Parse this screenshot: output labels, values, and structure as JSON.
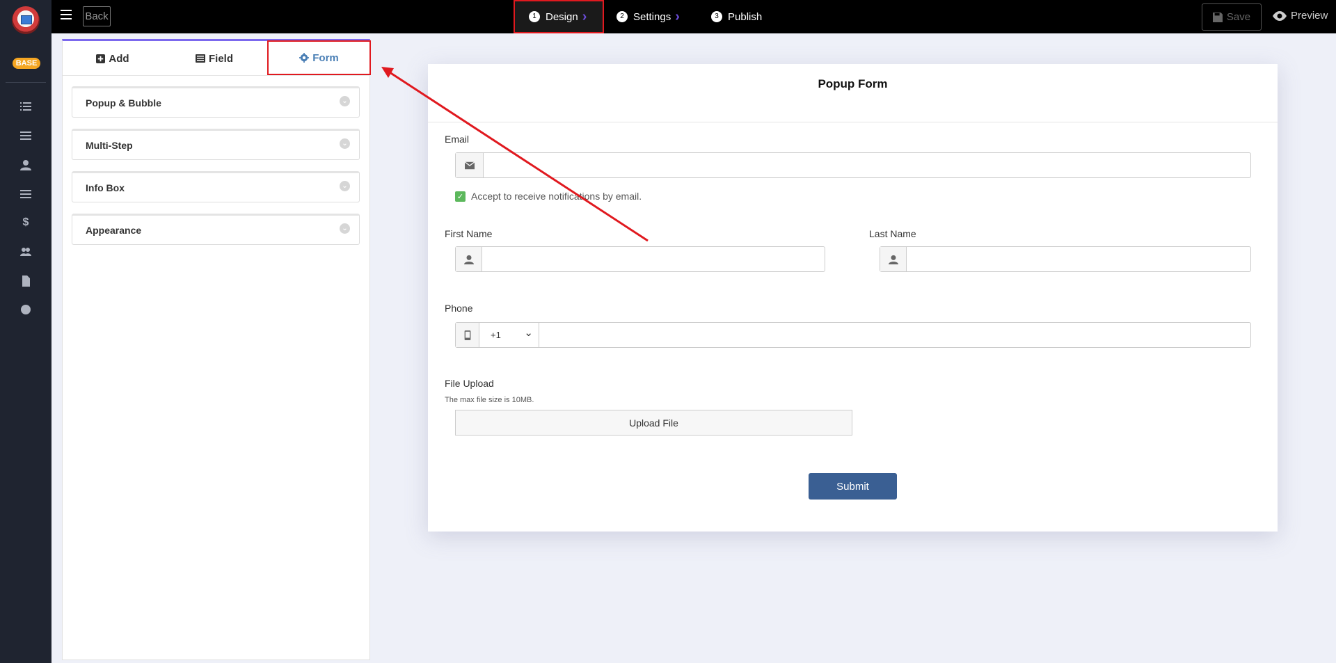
{
  "nav": {
    "badge": "BASE",
    "items": [
      "list-icon",
      "menu-icon",
      "user-icon",
      "menu-icon",
      "dollar-icon",
      "users-icon",
      "file-icon",
      "smile-icon"
    ]
  },
  "topbar": {
    "back_label": "Back",
    "steps": [
      {
        "num": "1",
        "label": "Design",
        "active": true
      },
      {
        "num": "2",
        "label": "Settings",
        "active": false
      },
      {
        "num": "3",
        "label": "Publish",
        "active": false
      }
    ],
    "save_label": "Save",
    "preview_label": "Preview"
  },
  "panel": {
    "tabs": [
      {
        "label": "Add",
        "icon": "plus-square-icon"
      },
      {
        "label": "Field",
        "icon": "list-alt-icon"
      },
      {
        "label": "Form",
        "icon": "gear-icon",
        "active": true
      }
    ],
    "sections": [
      "Popup & Bubble",
      "Multi-Step",
      "Info Box",
      "Appearance"
    ]
  },
  "form": {
    "title": "Popup Form",
    "email_label": "Email",
    "email_value": "",
    "consent_text": "Accept to receive notifications by email.",
    "first_name_label": "First Name",
    "last_name_label": "Last Name",
    "phone_label": "Phone",
    "phone_code": "+1",
    "file_upload_label": "File Upload",
    "file_hint": "The max file size is 10MB.",
    "upload_button": "Upload File",
    "submit_button": "Submit"
  },
  "colors": {
    "accent": "#7b68ee",
    "highlight": "#e0191f",
    "submit": "#3a5f93"
  }
}
